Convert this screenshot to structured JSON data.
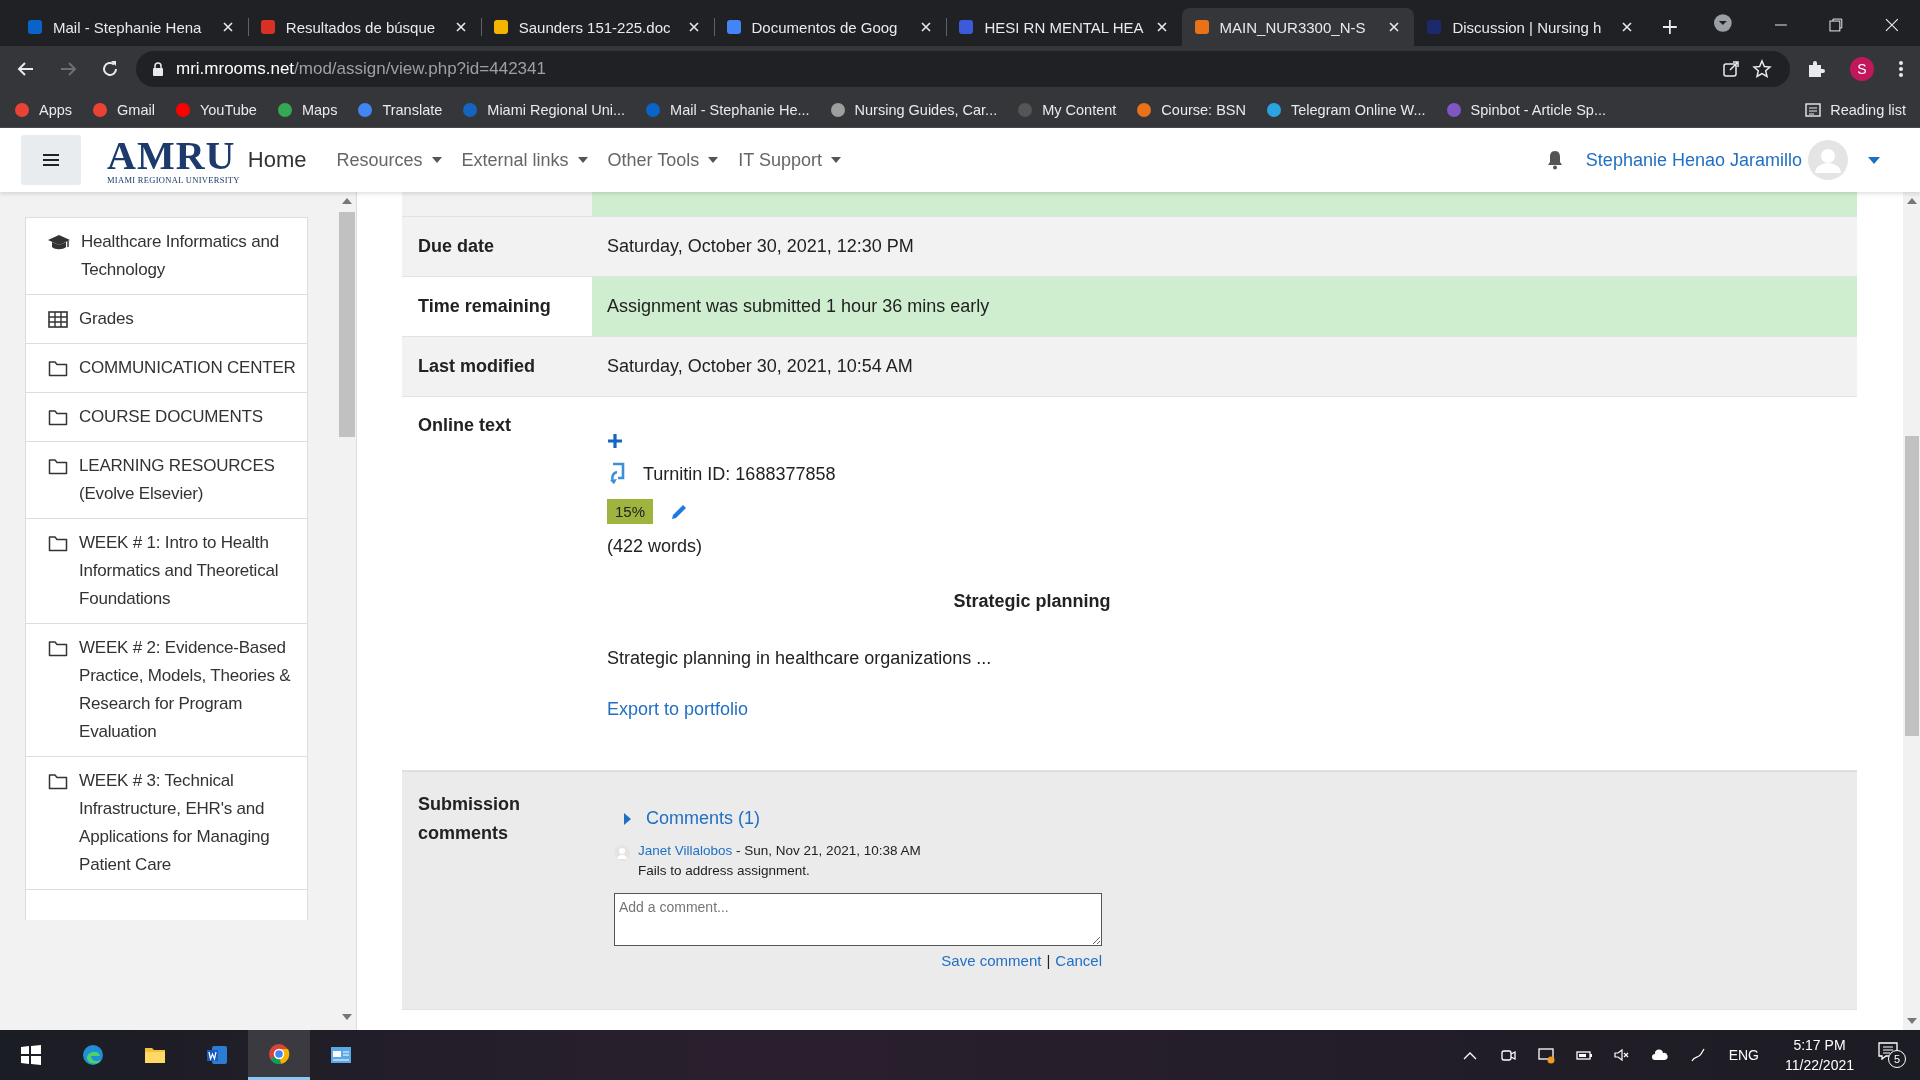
{
  "browser": {
    "tabs": [
      {
        "title": "Mail - Stephanie Hena",
        "color": "#0a64c8",
        "selected": false
      },
      {
        "title": "Resultados de búsque",
        "color": "#d93025",
        "selected": false
      },
      {
        "title": "Saunders 151-225.doc",
        "color": "#f4b400",
        "selected": false
      },
      {
        "title": "Documentos de Goog",
        "color": "#4285f4",
        "selected": false
      },
      {
        "title": "HESI RN MENTAL HEA",
        "color": "#3b5bdb",
        "selected": false
      },
      {
        "title": "MAIN_NUR3300_N-S",
        "color": "#e8711a",
        "selected": true
      },
      {
        "title": "Discussion | Nursing h",
        "color": "#1a2a6c",
        "selected": false
      }
    ],
    "url_host": "mri.mrooms.net",
    "url_path": "/mod/assign/view.php?id=442341",
    "profile_initial": "S",
    "bookmarks": [
      {
        "label": "Apps",
        "color": "#ea4335"
      },
      {
        "label": "Gmail",
        "color": "#ea4335"
      },
      {
        "label": "YouTube",
        "color": "#ff0000"
      },
      {
        "label": "Maps",
        "color": "#34a853"
      },
      {
        "label": "Translate",
        "color": "#4285f4"
      },
      {
        "label": "Miami Regional Uni...",
        "color": "#1565c0"
      },
      {
        "label": "Mail - Stephanie He...",
        "color": "#0a64c8"
      },
      {
        "label": "Nursing Guides, Car...",
        "color": "#9e9e9e"
      },
      {
        "label": "My Content",
        "color": "#555555"
      },
      {
        "label": "Course: BSN",
        "color": "#e8711a"
      },
      {
        "label": "Telegram Online W...",
        "color": "#2aa3e0"
      },
      {
        "label": "Spinbot - Article Sp...",
        "color": "#7e57c2"
      }
    ],
    "reading_list": "Reading list"
  },
  "site_header": {
    "logo": "AMRU",
    "logo_subtitle": "MIAMI REGIONAL UNIVERSITY",
    "home": "Home",
    "menus": [
      "Resources",
      "External links",
      "Other Tools",
      "IT Support"
    ],
    "user": "Stephanie Henao Jaramillo"
  },
  "sidebar": {
    "items": [
      {
        "kind": "course",
        "label": "Healthcare Informatics and Technology"
      },
      {
        "kind": "grades",
        "label": "Grades"
      },
      {
        "kind": "folder",
        "label": "COMMUNICATION CENTER"
      },
      {
        "kind": "folder",
        "label": "COURSE DOCUMENTS"
      },
      {
        "kind": "folder",
        "label": "LEARNING RESOURCES (Evolve Elsevier)"
      },
      {
        "kind": "folder",
        "label": "WEEK # 1: Intro to Health Informatics and Theoretical Foundations"
      },
      {
        "kind": "folder",
        "label": "WEEK # 2: Evidence-Based Practice, Models, Theories & Research for Program Evaluation"
      },
      {
        "kind": "folder",
        "label": "WEEK # 3: Technical Infrastructure, EHR's and Applications for Managing Patient Care"
      }
    ]
  },
  "submission_status": {
    "rows": [
      {
        "label": "Due date",
        "value": "Saturday, October 30, 2021, 12:30 PM",
        "highlight": false
      },
      {
        "label": "Time remaining",
        "value": "Assignment was submitted 1 hour 36 mins early",
        "highlight": true
      },
      {
        "label": "Last modified",
        "value": "Saturday, October 30, 2021, 10:54 AM",
        "highlight": false
      }
    ],
    "online_text": {
      "label": "Online text",
      "turnitin": "Turnitin ID: 1688377858",
      "similarity": "15%",
      "word_count": "(422 words)",
      "heading": "Strategic planning",
      "excerpt": "Strategic planning in healthcare organizations ...",
      "export_link": "Export to portfolio"
    },
    "comments": {
      "label": "Submission comments",
      "toggle": "Comments (1)",
      "expanded": false,
      "items": [
        {
          "author": "Janet Villalobos",
          "date": " - Sun, Nov 21, 2021, 10:38 AM",
          "text": "Fails to address assignment."
        }
      ],
      "placeholder": "Add a comment...",
      "save": "Save comment",
      "separator": "|",
      "cancel": "Cancel"
    }
  },
  "taskbar": {
    "apps": [
      {
        "kind": "start"
      },
      {
        "kind": "edge"
      },
      {
        "kind": "explorer"
      },
      {
        "kind": "word"
      },
      {
        "kind": "chrome",
        "selected": true
      },
      {
        "kind": "app",
        "selected": false
      }
    ],
    "language": "ENG",
    "time": "5:17 PM",
    "date": "11/22/2021",
    "notifications": "5"
  }
}
